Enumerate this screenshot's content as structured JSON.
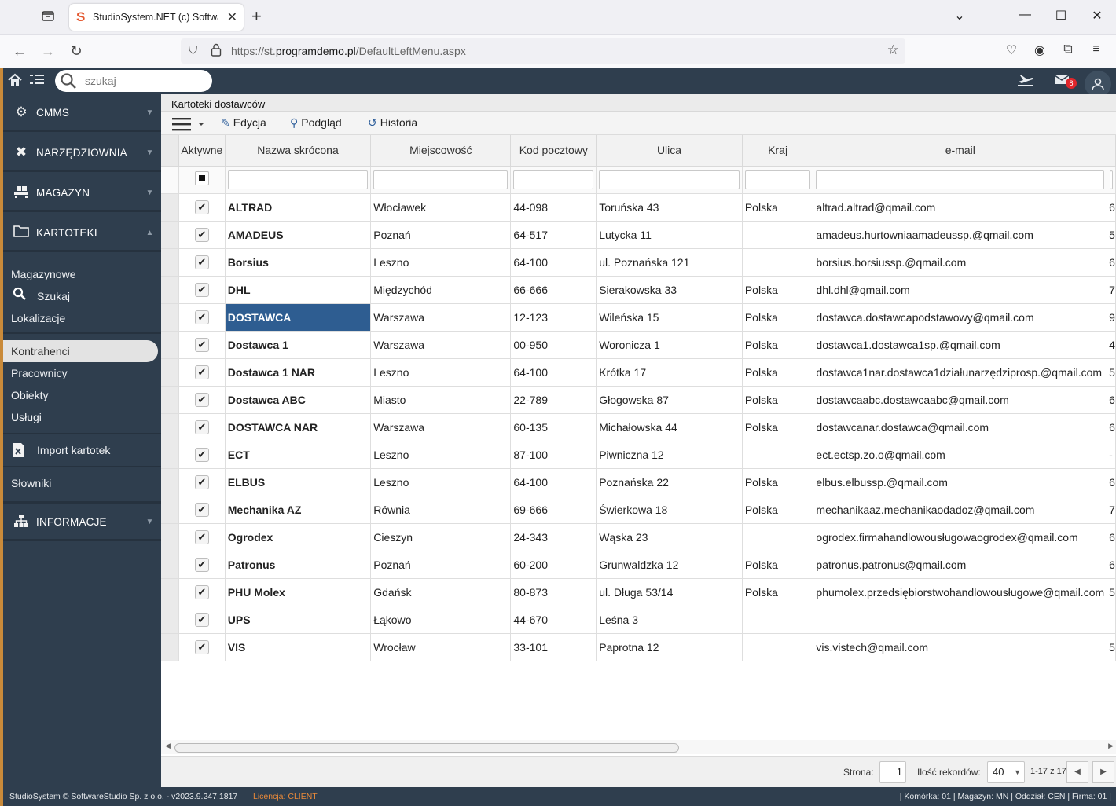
{
  "browser": {
    "tab_title": "StudioSystem.NET (c) SoftwareStudio",
    "url_prefix": "https://st.",
    "url_domain": "programdemo.pl",
    "url_path": "/DefaultLeftMenu.aspx",
    "new_tab": "+",
    "tab_close": "✕"
  },
  "header": {
    "search_placeholder": "szukaj",
    "mail_badge": "8"
  },
  "sidebar": {
    "sections": [
      {
        "label": "CMMS",
        "icon": "gears-icon"
      },
      {
        "label": "NARZĘDZIOWNIA",
        "icon": "tools-icon"
      },
      {
        "label": "MAGAZYN",
        "icon": "pallet-icon"
      },
      {
        "label": "KARTOTEKI",
        "icon": "folder-icon"
      },
      {
        "label": "INFORMACJE",
        "icon": "sitemap-icon"
      }
    ],
    "sub_items": {
      "magazynowe": "Magazynowe",
      "szukaj": "Szukaj",
      "lokalizacje": "Lokalizacje",
      "kontrahenci": "Kontrahenci",
      "pracownicy": "Pracownicy",
      "obiekty": "Obiekty",
      "uslugi": "Usługi",
      "import": "Import kartotek",
      "slowniki": "Słowniki"
    }
  },
  "main": {
    "title": "Kartoteki dostawców",
    "toolbar": {
      "edit": "Edycja",
      "preview": "Podgląd",
      "history": "Historia"
    },
    "columns": [
      "Aktywne",
      "Nazwa skrócona",
      "Miejscowość",
      "Kod pocztowy",
      "Ulica",
      "Kraj",
      "e-mail"
    ],
    "rows": [
      {
        "name": "ALTRAD",
        "city": "Włocławek",
        "zip": "44-098",
        "street": "Toruńska 43",
        "country": "Polska",
        "email": "altrad.altrad@qmail.com",
        "extra": "6"
      },
      {
        "name": "AMADEUS",
        "city": "Poznań",
        "zip": "64-517",
        "street": "Lutycka 11",
        "country": "",
        "email": "amadeus.hurtowniaamadeussp.@qmail.com",
        "extra": "5"
      },
      {
        "name": "Borsius",
        "city": "Leszno",
        "zip": "64-100",
        "street": "ul. Poznańska 121",
        "country": "",
        "email": "borsius.borsiussp.@qmail.com",
        "extra": "6"
      },
      {
        "name": "DHL",
        "city": "Międzychód",
        "zip": "66-666",
        "street": "Sierakowska 33",
        "country": "Polska",
        "email": "dhl.dhl@qmail.com",
        "extra": "7"
      },
      {
        "name": "DOSTAWCA",
        "city": "Warszawa",
        "zip": "12-123",
        "street": "Wileńska 15",
        "country": "Polska",
        "email": "dostawca.dostawcapodstawowy@qmail.com",
        "extra": "9"
      },
      {
        "name": "Dostawca 1",
        "city": "Warszawa",
        "zip": "00-950",
        "street": "Woronicza 1",
        "country": "Polska",
        "email": "dostawca1.dostawca1sp.@qmail.com",
        "extra": "4"
      },
      {
        "name": "Dostawca 1 NAR",
        "city": "Leszno",
        "zip": "64-100",
        "street": "Krótka 17",
        "country": "Polska",
        "email": "dostawca1nar.dostawca1działunarzędziprosp.@qmail.com",
        "extra": "5"
      },
      {
        "name": "Dostawca ABC",
        "city": "Miasto",
        "zip": "22-789",
        "street": "Głogowska 87",
        "country": "Polska",
        "email": "dostawcaabc.dostawcaabc@qmail.com",
        "extra": "6"
      },
      {
        "name": "DOSTAWCA NAR",
        "city": "Warszawa",
        "zip": "60-135",
        "street": "Michałowska 44",
        "country": "Polska",
        "email": "dostawcanar.dostawca@qmail.com",
        "extra": "6"
      },
      {
        "name": "ECT",
        "city": "Leszno",
        "zip": "87-100",
        "street": "Piwniczna 12",
        "country": "",
        "email": "ect.ectsp.zo.o@qmail.com",
        "extra": "-"
      },
      {
        "name": "ELBUS",
        "city": "Leszno",
        "zip": "64-100",
        "street": "Poznańska 22",
        "country": "Polska",
        "email": "elbus.elbussp.@qmail.com",
        "extra": "6"
      },
      {
        "name": "Mechanika AZ",
        "city": "Równia",
        "zip": "69-666",
        "street": "Świerkowa 18",
        "country": "Polska",
        "email": "mechanikaaz.mechanikaodadoz@qmail.com",
        "extra": "7"
      },
      {
        "name": "Ogrodex",
        "city": "Cieszyn",
        "zip": "24-343",
        "street": "Wąska 23",
        "country": "",
        "email": "ogrodex.firmahandlowousługowaogrodex@qmail.com",
        "extra": "6"
      },
      {
        "name": "Patronus",
        "city": "Poznań",
        "zip": "60-200",
        "street": "Grunwaldzka 12",
        "country": "Polska",
        "email": "patronus.patronus@qmail.com",
        "extra": "6"
      },
      {
        "name": "PHU Molex",
        "city": "Gdańsk",
        "zip": "80-873",
        "street": "ul. Długa 53/14",
        "country": "Polska",
        "email": "phumolex.przedsiębiorstwohandlowousługowe@qmail.com",
        "extra": "5"
      },
      {
        "name": "UPS",
        "city": "Łąkowo",
        "zip": "44-670",
        "street": "Leśna 3",
        "country": "",
        "email": "",
        "extra": ""
      },
      {
        "name": "VIS",
        "city": "Wrocław",
        "zip": "33-101",
        "street": "Paprotna 12",
        "country": "",
        "email": "vis.vistech@qmail.com",
        "extra": "5"
      }
    ],
    "selected_row": 4
  },
  "pager": {
    "page_label": "Strona:",
    "page_value": "1",
    "records_label": "Ilość rekordów:",
    "records_value": "40",
    "range": "1-17 z 17"
  },
  "status": {
    "left": "StudioSystem © SoftwareStudio Sp. z o.o. - v2023.9.247.1817",
    "license": "Licencja: CLIENT",
    "right": "| Komórka: 01 | Magazyn: MN | Oddział: CEN | Firma: 01 |"
  },
  "colors": {
    "sidebar_bg": "#2f3e4e",
    "accent": "#c98a3a",
    "selection": "#2e5d91",
    "badge": "#e0262b"
  }
}
